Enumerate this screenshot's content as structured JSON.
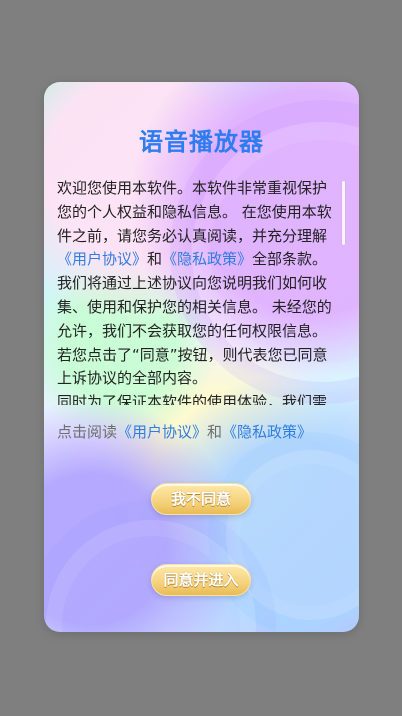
{
  "dialog": {
    "title": "语音播放器",
    "body_lines": [
      "欢迎您使用本软件。本软件非常重视保护",
      "您的个人权益和隐私信息。 在您使用本软",
      "件之前，请您务必认真阅读，并充分理解",
      "我们将通过上述协议向您说明我们如何收",
      "集、使用和保护您的相关信息。 未经您的",
      "允许，我们不会获取您的任何权限信息。",
      "若您点击了“同意”按钮，则代表您已同意",
      "上诉协议的全部内容。",
      " 同时为了保证本软件的使用体验，我们需"
    ],
    "body_link_line": {
      "link1": "《用户协议》",
      "and": "和",
      "link2": "《隐私政策》",
      "suffix": "全部条款。"
    },
    "read_prompt": {
      "prefix": "点击阅读",
      "link1": "《用户协议》",
      "and": "和",
      "link2": "《隐私政策》"
    },
    "buttons": {
      "disagree": "我不同意",
      "agree": "同意并进入"
    }
  },
  "colors": {
    "title": "#2e7df0",
    "link": "#2f7de1",
    "overlay": "#7f7f7f",
    "button_gold": "#f5d27c"
  }
}
